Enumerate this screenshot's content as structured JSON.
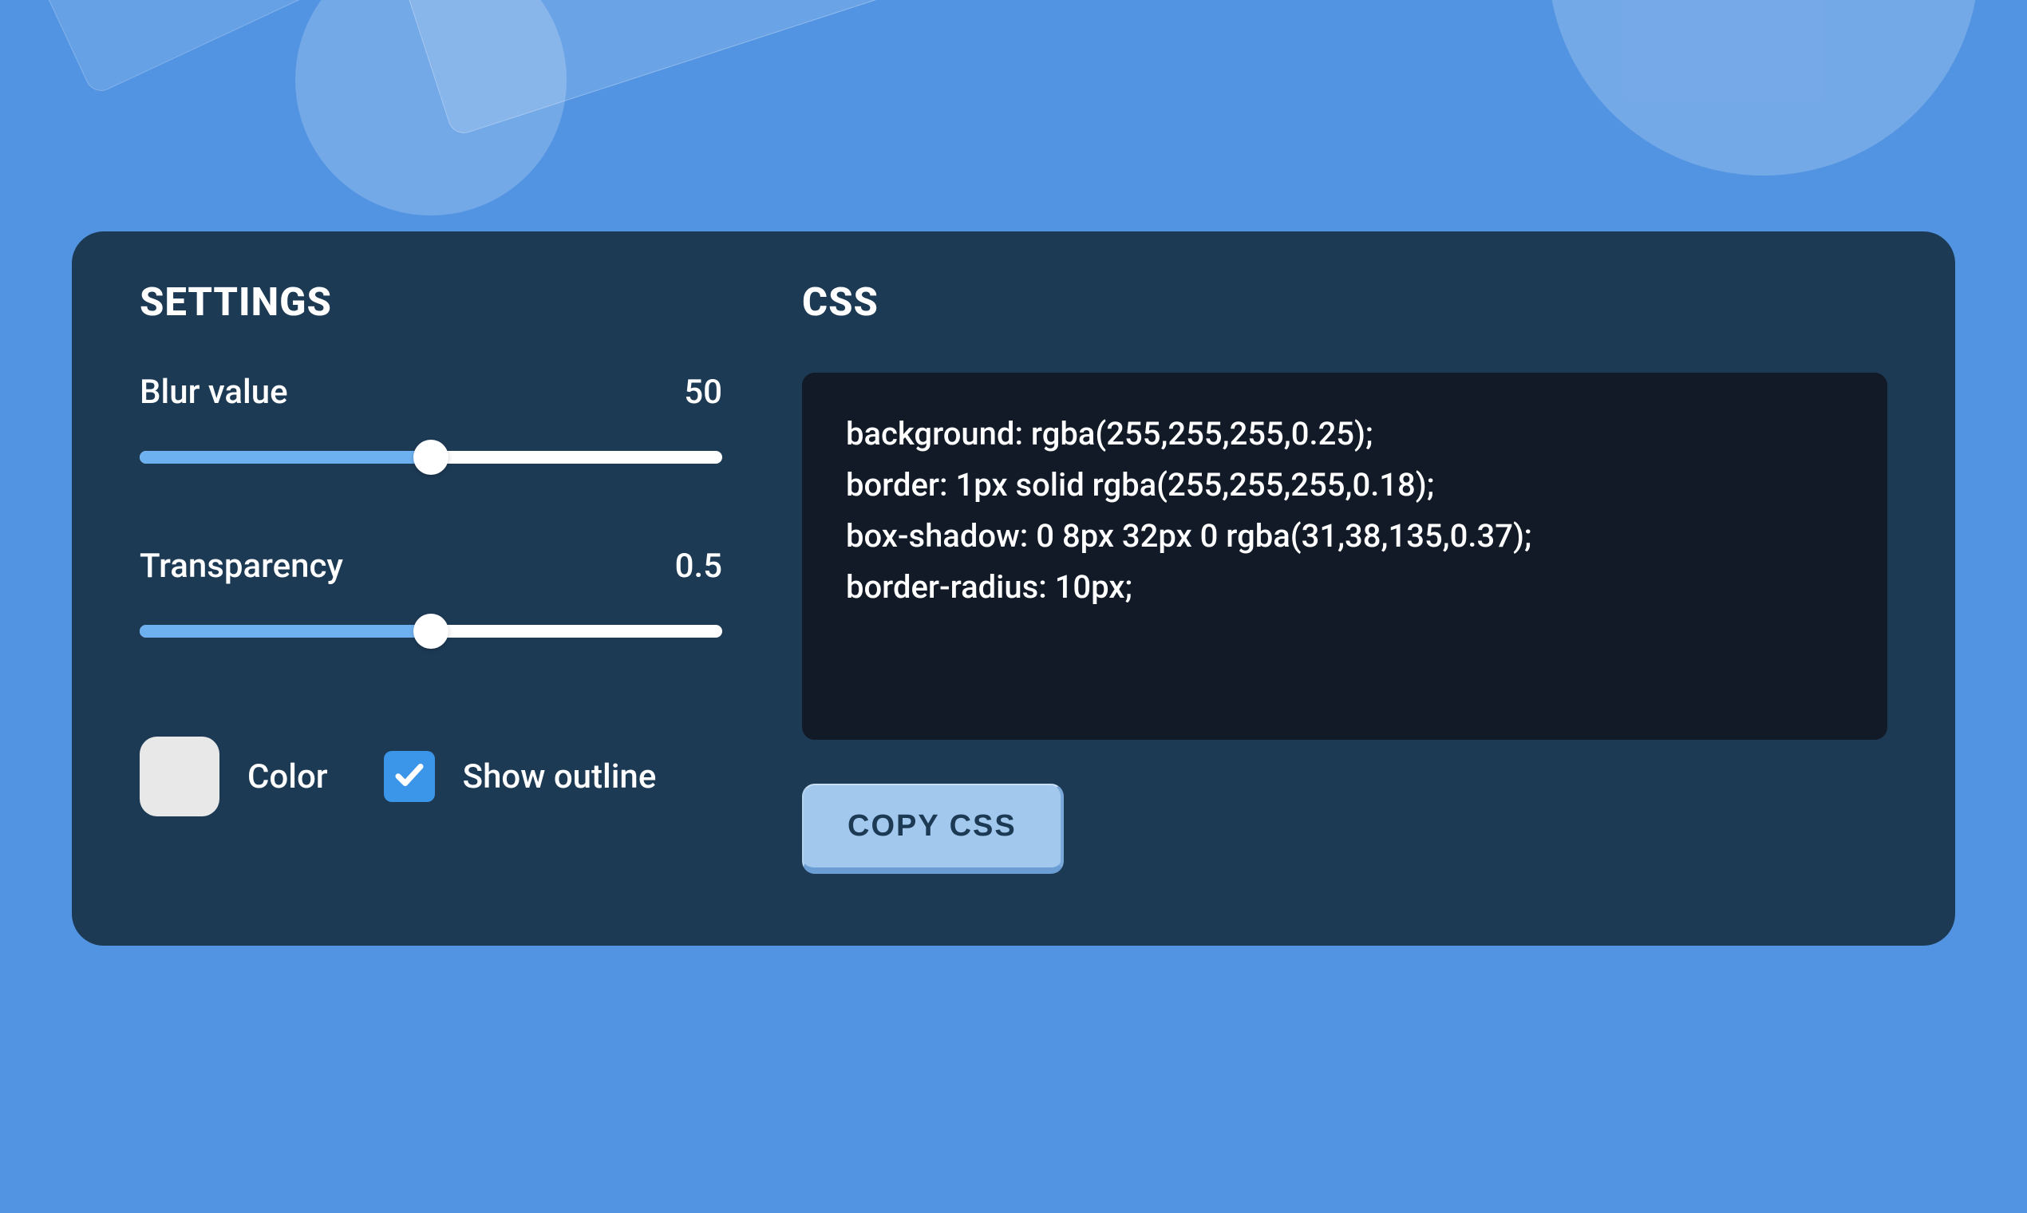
{
  "settings": {
    "title": "SETTINGS",
    "blur": {
      "label": "Blur value",
      "value": "50",
      "percent": 50
    },
    "transparency": {
      "label": "Transparency",
      "value": "0.5",
      "percent": 50
    },
    "color": {
      "label": "Color",
      "swatch_hex": "#e8e8e8"
    },
    "outline": {
      "label": "Show outline",
      "checked": true
    }
  },
  "css": {
    "title": "CSS",
    "code": "background: rgba(255,255,255,0.25);\nborder: 1px solid rgba(255,255,255,0.18);\nbox-shadow: 0 8px 32px 0 rgba(31,38,135,0.37);\nborder-radius: 10px;",
    "copy_label": "COPY CSS"
  }
}
